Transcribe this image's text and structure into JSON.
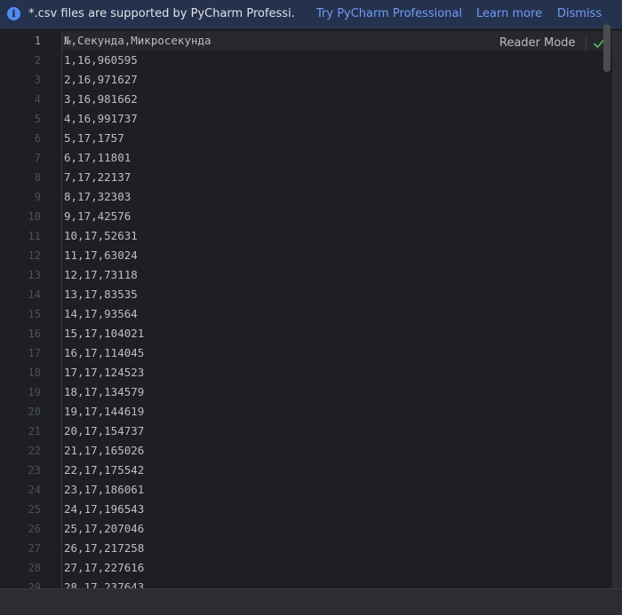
{
  "banner": {
    "icon": "info-icon",
    "icon_glyph": "i",
    "message": "*.csv files are supported by PyCharm Professi...",
    "try_label": "Try PyCharm Professional",
    "learn_label": "Learn more",
    "dismiss_label": "Dismiss",
    "accent_color": "#548af7",
    "link_color": "#6f9bf8"
  },
  "editor": {
    "reader_mode_label": "Reader Mode",
    "inspection_icon": "check-icon",
    "inspection_color": "#5fb865",
    "current_line": 1,
    "lines": [
      "№,Секунда,Микросекунда",
      "1,16,960595",
      "2,16,971627",
      "3,16,981662",
      "4,16,991737",
      "5,17,1757",
      "6,17,11801",
      "7,17,22137",
      "8,17,32303",
      "9,17,42576",
      "10,17,52631",
      "11,17,63024",
      "12,17,73118",
      "13,17,83535",
      "14,17,93564",
      "15,17,104021",
      "16,17,114045",
      "17,17,124523",
      "18,17,134579",
      "19,17,144619",
      "20,17,154737",
      "21,17,165026",
      "22,17,175542",
      "23,17,186061",
      "24,17,196543",
      "25,17,207046",
      "26,17,217258",
      "27,17,227616",
      "28,17,237643"
    ]
  }
}
